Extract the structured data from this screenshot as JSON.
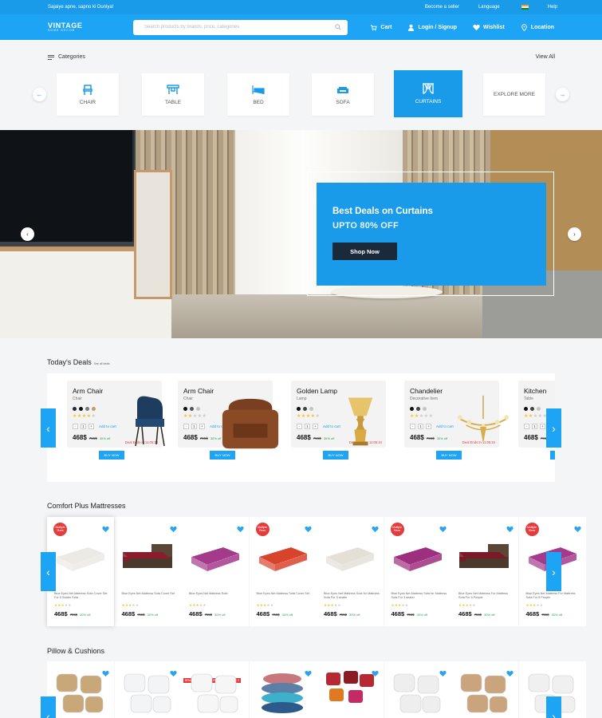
{
  "topbar": {
    "tagline": "Sajaiye apne, sapno ki Duniya!",
    "become_seller": "Become a seller",
    "language": "Language",
    "help": "Help"
  },
  "header": {
    "logo_main": "VINTAGE",
    "logo_sub": "HOME DECOR",
    "search_placeholder": "Search products by brands, price, categories",
    "cart": "Cart",
    "login": "Login / Signup",
    "wishlist": "Wishlist",
    "location": "Location"
  },
  "categories": {
    "title": "Categories",
    "view_all": "View All",
    "items": [
      {
        "label": "CHAIR",
        "icon": "chair-icon"
      },
      {
        "label": "TABLE",
        "icon": "table-icon"
      },
      {
        "label": "BED",
        "icon": "bed-icon"
      },
      {
        "label": "SOFA",
        "icon": "sofa-icon"
      },
      {
        "label": "CURTAINS",
        "icon": "curtains-icon",
        "active": true
      },
      {
        "label": "EXPLORE MORE",
        "icon": ""
      }
    ]
  },
  "hero": {
    "title": "Best Deals on Curtains",
    "subtitle": "UPTO 80% OFF",
    "cta": "Shop Now"
  },
  "deals": {
    "title": "Today's Deals",
    "see_all": "See all deals",
    "items": [
      {
        "name": "Arm Chair",
        "category": "Chair",
        "price": "468$",
        "old": "755$",
        "disc": "30% off",
        "ends": "Deal Ends In 11:05:34",
        "rating": 4,
        "colors": [
          "#1c2b3a",
          "#111111",
          "#7a7a7a",
          "#c49a6c"
        ]
      },
      {
        "name": "Arm Chair",
        "category": "Chair",
        "price": "468$",
        "old": "755$",
        "disc": "30% off",
        "ends": "Deal Ends In 11:05:34",
        "rating": 2,
        "colors": [
          "#111111",
          "#555555",
          "#c4c4c4"
        ]
      },
      {
        "name": "Golden Lamp",
        "category": "Lamp",
        "price": "468$",
        "old": "755$",
        "disc": "30% off",
        "ends": "Deal Ends In 11:05:34",
        "rating": 4,
        "colors": [
          "#111111",
          "#444444",
          "#c4c4c4"
        ]
      },
      {
        "name": "Chandelier",
        "category": "Decorative Item",
        "price": "468$",
        "old": "755$",
        "disc": "30% off",
        "ends": "Deal Ends In 11:05:34",
        "rating": 2,
        "colors": [
          "#111111",
          "#444444",
          "#c4c4c4"
        ]
      },
      {
        "name": "Kitchen",
        "category": "Table",
        "price": "468$",
        "old": "755$",
        "disc": "30% off",
        "ends": "",
        "rating": 2,
        "colors": [
          "#111111",
          "#444444",
          "#c4c4c4"
        ]
      }
    ],
    "add_to_cart": "Add to cart",
    "buy_now": "BUY NOW",
    "qty": "1"
  },
  "mattresses": {
    "title": "Comfort Plus Mattresses",
    "items": [
      {
        "badge": "Multiple Sizes",
        "desc": "Blue Eyes Net Mattress Sofa Cover Set For 5 Seater Sofa",
        "color": "#eceae4",
        "price": "468$",
        "old": "755$",
        "disc": "30% off"
      },
      {
        "badge": "",
        "desc": "Blue Eyes Net Mattress Sofa Cover Set",
        "color": "#8a1c2c",
        "price": "468$",
        "old": "755$",
        "disc": "30% off"
      },
      {
        "badge": "",
        "desc": "Blue Eyes Net Mattress Sofa",
        "color": "#a43a8c",
        "price": "468$",
        "old": "755$",
        "disc": "30% off"
      },
      {
        "badge": "Multiple Sizes",
        "desc": "Blue Eyes Net Mattress Sofa Cover Set",
        "color": "#d8432c",
        "price": "468$",
        "old": "755$",
        "disc": "30% off"
      },
      {
        "badge": "",
        "desc": "Blue Eyes Net Mattress Sofa for Mattress Sofa For 3 seater",
        "color": "#e4e0d8",
        "price": "468$",
        "old": "755$",
        "disc": "30% off"
      },
      {
        "badge": "Multiple Sizes",
        "desc": "Blue Eyes Net Mattress Sofa for Mattress Sofa For 3 seater",
        "color": "#9e2e7e",
        "price": "468$",
        "old": "755$",
        "disc": "30% off"
      },
      {
        "badge": "",
        "desc": "Blue Eyes Net Mattress For Mattress Sofa For 5 People",
        "color": "#7a1a26",
        "price": "468$",
        "old": "755$",
        "disc": "30% off"
      },
      {
        "badge": "Multiple Sizes",
        "desc": "Blue Eyes Net Mattress For Mattress Sofa For 5 People",
        "color": "#a43a8c",
        "price": "468$",
        "old": "755$",
        "disc": "30% off"
      }
    ]
  },
  "pillows": {
    "title": "Pillow & Cushions",
    "brand_tag": "BRANDED RECRON PILLOW - SET OF 2",
    "items": [
      {
        "color": "#c8a878"
      },
      {
        "color": "#f2f4f6"
      },
      {
        "color": "#f6f6f6"
      },
      {
        "color": "#5b7fa6"
      },
      {
        "color": "#b82832"
      },
      {
        "color": "#eeeeee"
      },
      {
        "color": "#c9a47c"
      },
      {
        "color": "#f0f0f0"
      }
    ]
  }
}
